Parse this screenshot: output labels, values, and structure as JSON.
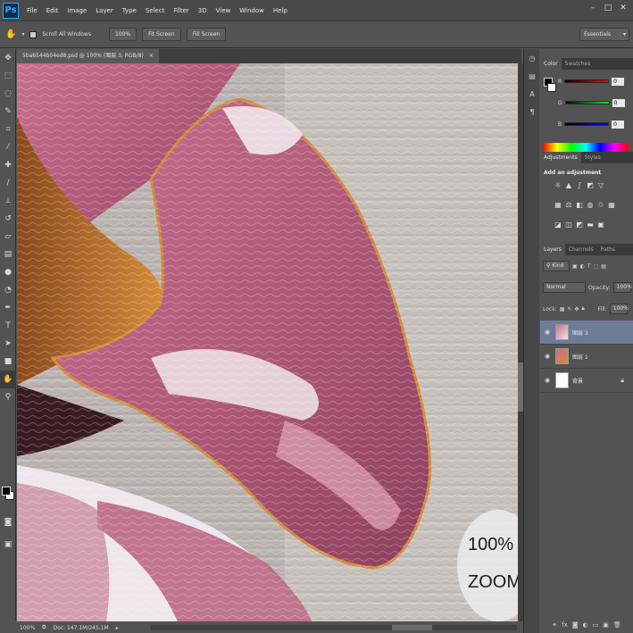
{
  "app": {
    "logo": "Ps"
  },
  "menu": [
    "File",
    "Edit",
    "Image",
    "Layer",
    "Type",
    "Select",
    "Filter",
    "3D",
    "View",
    "Window",
    "Help"
  ],
  "window_controls": {
    "minimize": "–",
    "maximize": "□",
    "close": "✕"
  },
  "options_bar": {
    "scroll_all_windows": "Scroll All Windows",
    "zoom_100": "100%",
    "fit_screen": "Fit Screen",
    "fill_screen": "Fill Screen",
    "workspace": "Essentials"
  },
  "document": {
    "tab_title": "5ba6544b04ed8.psd @ 100% (图层 3, RGB/8)",
    "close": "×",
    "watermark_line1": "100%",
    "watermark_line2": "ZOOM"
  },
  "status": {
    "zoom": "100%",
    "doc": "Doc: 147.1M/245.1M"
  },
  "color_panel": {
    "tab_color": "Color",
    "tab_swatches": "Swatches",
    "r_label": "R",
    "g_label": "G",
    "b_label": "B",
    "r_value": "0",
    "g_value": "0",
    "b_value": "0"
  },
  "adjustments_panel": {
    "tab_adjustments": "Adjustments",
    "tab_styles": "Styles",
    "title": "Add an adjustment"
  },
  "layers_panel": {
    "tab_layers": "Layers",
    "tab_channels": "Channels",
    "tab_paths": "Paths",
    "filter_kind": "Kind",
    "blend_mode": "Normal",
    "opacity_label": "Opacity:",
    "opacity_value": "100%",
    "lock_label": "Lock:",
    "fill_label": "Fill:",
    "fill_value": "100%",
    "layers": [
      {
        "name": "图层 3",
        "selected": true
      },
      {
        "name": "图层 1",
        "selected": false
      },
      {
        "name": "背景",
        "selected": false
      }
    ]
  },
  "colors": {
    "ui_dark": "#535353",
    "selection": "#6d7c96",
    "petal_pink": "#b05a7a",
    "petal_highlight": "#f0e6ee",
    "petal_edge": "#c98a3c",
    "background_wall": "#b9b2ae"
  },
  "tools": [
    "move-icon",
    "marquee-icon",
    "lasso-icon",
    "quick-select-icon",
    "crop-icon",
    "eyedropper-icon",
    "healing-icon",
    "brush-icon",
    "stamp-icon",
    "history-brush-icon",
    "eraser-icon",
    "gradient-icon",
    "blur-icon",
    "dodge-icon",
    "pen-icon",
    "type-icon",
    "path-select-icon",
    "shape-icon",
    "hand-icon",
    "zoom-icon"
  ]
}
